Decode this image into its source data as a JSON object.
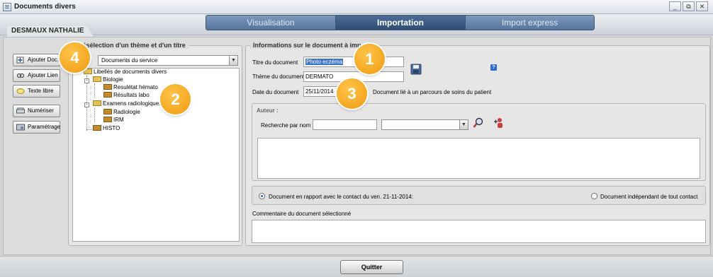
{
  "window": {
    "title": "Documents divers",
    "minimize": "_",
    "restore": "⧉",
    "close": "✕"
  },
  "header": {
    "patient_name": "DESMAUX NATHALIE",
    "tabs": [
      {
        "label": "Visualisation",
        "active": false
      },
      {
        "label": "Importation",
        "active": true
      },
      {
        "label": "Import express",
        "active": false
      }
    ]
  },
  "left_buttons": {
    "add_doc": "Ajouter Doc.",
    "add_link": "Ajouter Lien",
    "free_text": "Texte libre",
    "scan": "Numériser",
    "settings": "Paramétrage"
  },
  "preselection": {
    "title": "Présélection d'un thème et d'un titre",
    "dropdown_value": "Documents du service",
    "tree": {
      "root": "Libellés de documents divers",
      "biology": "Biologie",
      "bio_items": [
        "Resulétat hémato",
        "Résultats labo"
      ],
      "radiology_group": "Examens radiologiques",
      "radio_items": [
        "Radiologie",
        "IRM"
      ],
      "histo": "HISTO"
    }
  },
  "info": {
    "title": "Informations sur le document à importer",
    "title_label": "Titre du document",
    "title_value": "Photo eczéma",
    "theme_label": "Thème du document",
    "theme_value": "DERMATO",
    "date_label": "Date du document",
    "date_value": "25/11/2014",
    "care_path_label": "Document lié à un parcours de soins du patient",
    "help": "?",
    "author_title": "Auteur :",
    "search_label": "Recherche par nom",
    "radio_contact": "Document en rapport avec le contact du ven. 21-11-2014:",
    "radio_independent": "Document indépendant de tout contact",
    "comment_label": "Commentaire du document sélectionné"
  },
  "badges": [
    "1",
    "2",
    "3",
    "4"
  ],
  "footer": {
    "quit": "Quitter"
  },
  "colors": {
    "tab_active": "#2e4d75",
    "tab_inactive": "#56759c",
    "badge": "#f09a10",
    "selection": "#3a73c9"
  }
}
